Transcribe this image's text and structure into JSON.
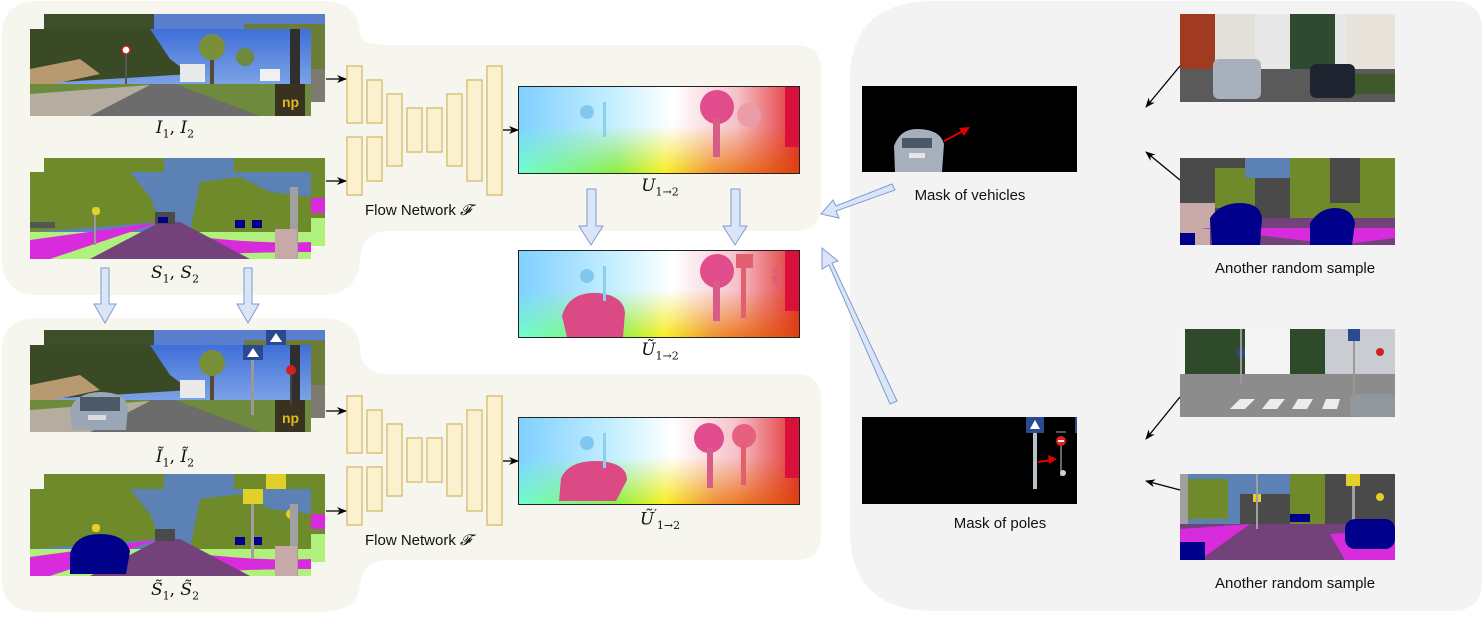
{
  "figure": {
    "colors": {
      "panel_cream": "#f6f5ee",
      "panel_gray": "#f3f3f3",
      "network_fill": "#fbf1cf",
      "network_stroke": "#d9c27a",
      "big_arrow_fill": "#dae6f8",
      "big_arrow_stroke": "#7f9bcf",
      "motion_arrow": "#e00000"
    },
    "left_top": {
      "images_label": "I_1, I_2",
      "images_label_parts": {
        "a": "I",
        "a_sub": "1",
        "b": "I",
        "b_sub": "2"
      },
      "seg_label_parts": {
        "a": "S",
        "a_sub": "1",
        "b": "S",
        "b_sub": "2"
      },
      "network_label": "Flow Network",
      "network_symbol": "𝓕",
      "flow_label_parts": {
        "a": "U",
        "a_sub": "1→2"
      }
    },
    "middle": {
      "augmented_flow_label_parts": {
        "a": "Ũ",
        "a_sub": "1→2"
      }
    },
    "left_bottom": {
      "images_label_parts": {
        "a": "Ĩ",
        "a_sub": "1",
        "b": "Ĩ",
        "b_sub": "2"
      },
      "seg_label_parts": {
        "a": "S̃",
        "a_sub": "1",
        "b": "S̃",
        "b_sub": "2"
      },
      "network_label": "Flow Network",
      "network_symbol": "𝓕",
      "flow_label_parts": {
        "a": "Ũ",
        "prime": "′",
        "a_sub": "1→2"
      }
    },
    "right": {
      "vehicles_mask_caption": "Mask of vehicles",
      "poles_mask_caption": "Mask of poles",
      "sample_caption_top": "Another random sample",
      "sample_caption_bottom": "Another random sample"
    },
    "icons": {
      "arrow": "black-arrow-icon",
      "big_arrow": "hollow-block-arrow-icon",
      "motion_arrow": "red-motion-arrow-icon"
    }
  }
}
